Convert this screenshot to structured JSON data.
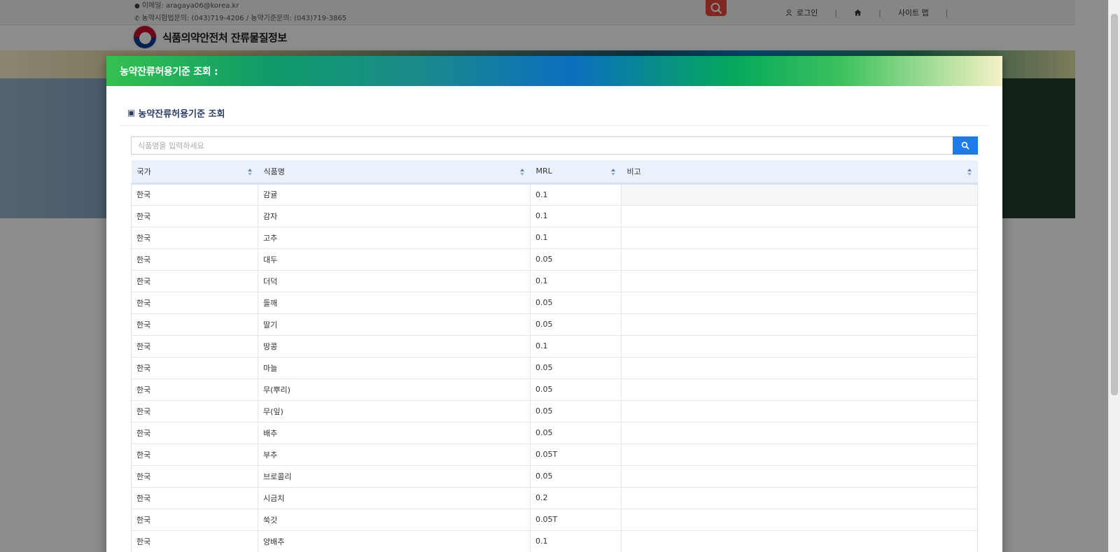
{
  "topbar": {
    "email": "이메일: aragaya06@korea.kr",
    "phones": "농약시험법문의: (043)719-4206 / 농약기준문의: (043)719-3865",
    "login_label": "로그인",
    "sitemap_label": "사이트 맵"
  },
  "brand": {
    "name": "식품의약안전처 잔류물질정보"
  },
  "modal": {
    "title": "농약잔류허용기준 조회 :",
    "section_title": "농약잔류허용기준 조회",
    "search_placeholder": "식품명을 입력하세요"
  },
  "table": {
    "columns": [
      "국가",
      "식품명",
      "MRL",
      "비고"
    ],
    "rows": [
      {
        "country": "한국",
        "food": "감귤",
        "mrl": "0.1",
        "note": ""
      },
      {
        "country": "한국",
        "food": "감자",
        "mrl": "0.1",
        "note": ""
      },
      {
        "country": "한국",
        "food": "고추",
        "mrl": "0.1",
        "note": ""
      },
      {
        "country": "한국",
        "food": "대두",
        "mrl": "0.05",
        "note": ""
      },
      {
        "country": "한국",
        "food": "더덕",
        "mrl": "0.1",
        "note": ""
      },
      {
        "country": "한국",
        "food": "들깨",
        "mrl": "0.05",
        "note": ""
      },
      {
        "country": "한국",
        "food": "딸기",
        "mrl": "0.05",
        "note": ""
      },
      {
        "country": "한국",
        "food": "땅콩",
        "mrl": "0.1",
        "note": ""
      },
      {
        "country": "한국",
        "food": "마늘",
        "mrl": "0.05",
        "note": ""
      },
      {
        "country": "한국",
        "food": "무(뿌리)",
        "mrl": "0.05",
        "note": ""
      },
      {
        "country": "한국",
        "food": "무(잎)",
        "mrl": "0.05",
        "note": ""
      },
      {
        "country": "한국",
        "food": "배추",
        "mrl": "0.05",
        "note": ""
      },
      {
        "country": "한국",
        "food": "부추",
        "mrl": "0.05T",
        "note": ""
      },
      {
        "country": "한국",
        "food": "브로콜리",
        "mrl": "0.05",
        "note": ""
      },
      {
        "country": "한국",
        "food": "시금치",
        "mrl": "0.2",
        "note": ""
      },
      {
        "country": "한국",
        "food": "쑥갓",
        "mrl": "0.05T",
        "note": ""
      },
      {
        "country": "한국",
        "food": "양배추",
        "mrl": "0.1",
        "note": ""
      }
    ]
  },
  "colors": {
    "accent_blue": "#1e7ce8",
    "search_red": "#e8473b",
    "header_bg": "#ebf1fa"
  },
  "icons": {
    "top_search": "search-icon",
    "login": "user-icon",
    "home": "home-icon",
    "search_submit": "search-icon",
    "section": "square-icon",
    "sort": "sort-icon"
  }
}
